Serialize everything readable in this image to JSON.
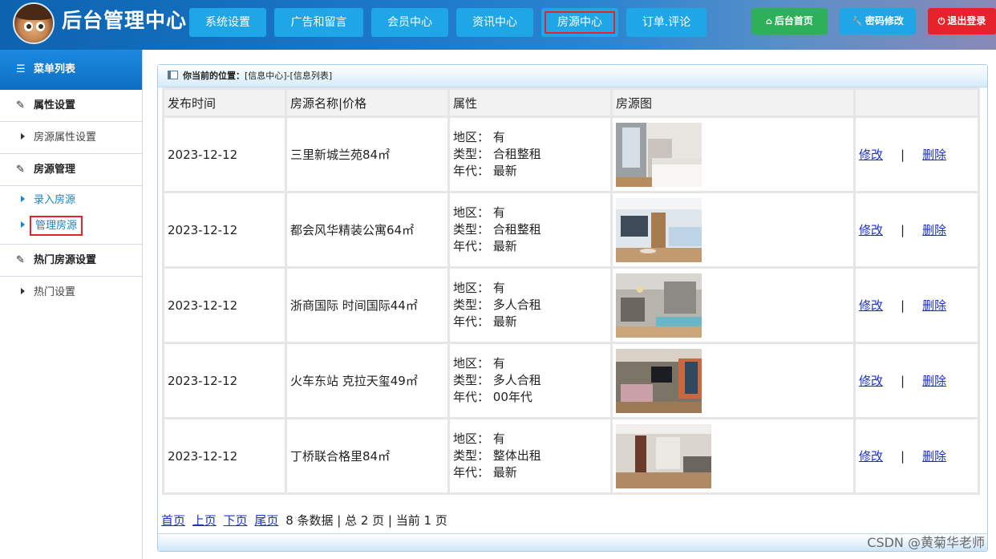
{
  "header": {
    "title": "后台管理中心",
    "nav": [
      {
        "label": "系统设置"
      },
      {
        "label": "广告和留言"
      },
      {
        "label": "会员中心"
      },
      {
        "label": "资讯中心"
      },
      {
        "label": "房源中心"
      },
      {
        "label": "订单.评论"
      }
    ],
    "actions": {
      "home": "后台首页",
      "password": "密码修改",
      "logout": "退出登录"
    },
    "colors": {
      "home": "#2eb05a",
      "password": "#1fa6e6",
      "logout": "#e8222a"
    }
  },
  "sidebar": {
    "title": "菜单列表",
    "sections": [
      {
        "label": "属性设置",
        "items": [
          "房源属性设置"
        ]
      },
      {
        "label": "房源管理",
        "items": [
          "录入房源",
          "管理房源"
        ]
      },
      {
        "label": "热门房源设置",
        "items": [
          "热门设置"
        ]
      }
    ]
  },
  "main": {
    "crumb_label": "你当前的位置：",
    "crumb_path": "[信息中心]-[信息列表]",
    "columns": [
      "发布时间",
      "房源名称|价格",
      "属性",
      "房源图",
      ""
    ],
    "attr_labels": {
      "region": "地区：",
      "type": "类型：",
      "age": "年代："
    },
    "rows": [
      {
        "date": "2023-12-12",
        "name": "三里新城兰苑84㎡",
        "region": "有",
        "type": "合租整租",
        "age": "最新",
        "edit": "修改",
        "delete": "删除",
        "sep": "|"
      },
      {
        "date": "2023-12-12",
        "name": "都会风华精装公寓64㎡",
        "region": "有",
        "type": "合租整租",
        "age": "最新",
        "edit": "修改",
        "delete": "删除",
        "sep": "|"
      },
      {
        "date": "2023-12-12",
        "name": "浙商国际 时间国际44㎡",
        "region": "有",
        "type": "多人合租",
        "age": "最新",
        "edit": "修改",
        "delete": "删除",
        "sep": "|"
      },
      {
        "date": "2023-12-12",
        "name": "火车东站 克拉天玺49㎡",
        "region": "有",
        "type": "多人合租",
        "age": "00年代",
        "edit": "修改",
        "delete": "删除",
        "sep": "|"
      },
      {
        "date": "2023-12-12",
        "name": "丁桥联合格里84㎡",
        "region": "有",
        "type": "整体出租",
        "age": "最新",
        "edit": "修改",
        "delete": "删除",
        "sep": "|"
      }
    ],
    "pager": {
      "first": "首页",
      "prev": "上页",
      "next": "下页",
      "last": "尾页",
      "summary": "8 条数据 | 总 2 页 | 当前 1 页"
    }
  },
  "watermark": "CSDN @黄菊华老师"
}
